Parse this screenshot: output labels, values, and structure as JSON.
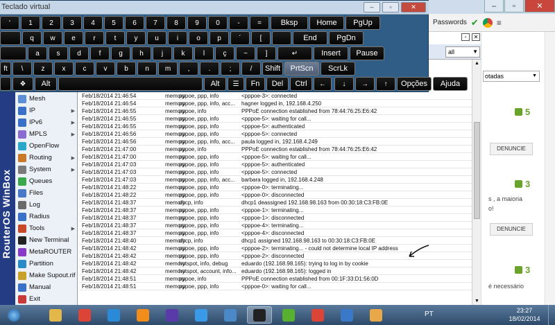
{
  "keyboard": {
    "title": "Teclado virtual",
    "rows": [
      [
        "'",
        "1",
        "2",
        "3",
        "4",
        "5",
        "6",
        "7",
        "8",
        "9",
        "0",
        "-",
        "=",
        "Bksp",
        "Home",
        "PgUp"
      ],
      [
        "",
        "q",
        "w",
        "e",
        "r",
        "t",
        "y",
        "u",
        "i",
        "o",
        "p",
        "´",
        "[",
        "",
        "End",
        "PgDn"
      ],
      [
        "",
        "a",
        "s",
        "d",
        "f",
        "g",
        "h",
        "j",
        "k",
        "l",
        "ç",
        "~",
        "]",
        "",
        "Insert",
        "Pause"
      ],
      [
        "ft",
        "\\",
        "z",
        "x",
        "c",
        "v",
        "b",
        "n",
        "m",
        ",",
        ".",
        ";",
        "/",
        "Shift",
        "PrtScn",
        "ScrLk"
      ],
      [
        "",
        "",
        "Alt",
        "",
        "Alt",
        "",
        "Fn",
        "Del",
        "Ctrl",
        "",
        "",
        "",
        "",
        "Opções",
        "Ajuda"
      ]
    ],
    "shift_chars": [
      "\"",
      "!",
      "@",
      "#",
      "$",
      "%",
      "¨",
      "&",
      "*",
      "(",
      ")",
      "_",
      "+"
    ],
    "alt_chars": {
      "2": "²",
      "3": "³",
      "4": "£",
      "5": "¢",
      "6": "¬",
      "=": "§",
      "´": "`",
      "[": "{",
      "ç": "Ç",
      "~": "^",
      "]": "}",
      ",": "<",
      ".": ">",
      ";": ":",
      "/": "?"
    }
  },
  "chrome": {
    "passwords": "Passwords",
    "menu": "≡"
  },
  "winbox": {
    "filter": "all",
    "brand": "RouterOS WinBox",
    "menu": [
      {
        "label": "Mesh",
        "color": "#5c8fd6",
        "sub": false
      },
      {
        "label": "IP",
        "color": "#3a70c8",
        "sub": true
      },
      {
        "label": "IPv6",
        "color": "#3a70c8",
        "sub": true
      },
      {
        "label": "MPLS",
        "color": "#8a6bcf",
        "sub": true
      },
      {
        "label": "OpenFlow",
        "color": "#2aa6c8",
        "sub": false
      },
      {
        "label": "Routing",
        "color": "#c87a2a",
        "sub": true
      },
      {
        "label": "System",
        "color": "#7a7a7a",
        "sub": true
      },
      {
        "label": "Queues",
        "color": "#3aa84a",
        "sub": false
      },
      {
        "label": "Files",
        "color": "#4a78c8",
        "sub": false
      },
      {
        "label": "Log",
        "color": "#6a6a6a",
        "sub": false
      },
      {
        "label": "Radius",
        "color": "#3a70c8",
        "sub": false
      },
      {
        "label": "Tools",
        "color": "#c84a2a",
        "sub": true
      },
      {
        "label": "New Terminal",
        "color": "#222222",
        "sub": false
      },
      {
        "label": "MetaROUTER",
        "color": "#8a3ac8",
        "sub": false
      },
      {
        "label": "Partition",
        "color": "#2a8ac8",
        "sub": false
      },
      {
        "label": "Make Supout.rif",
        "color": "#c8a02a",
        "sub": false
      },
      {
        "label": "Manual",
        "color": "#3a70c8",
        "sub": false
      },
      {
        "label": "Exit",
        "color": "#c83a3a",
        "sub": false
      }
    ],
    "log": [
      [
        "Feb/18/2014 21:46:54",
        "memory",
        "pppoe, ppp, info",
        "<pppoe-3>: connected"
      ],
      [
        "Feb/18/2014 21:46:54",
        "memory",
        "pppoe, ppp, info, acc...",
        "hagner logged in, 192.168.4.250"
      ],
      [
        "Feb/18/2014 21:46:55",
        "memory",
        "pppoe, info",
        "PPPoE connection established from 78:44:76:25:E6:42"
      ],
      [
        "Feb/18/2014 21:46:55",
        "memory",
        "pppoe, ppp, info",
        "<pppoe-5>: waiting for call..."
      ],
      [
        "Feb/18/2014 21:46:55",
        "memory",
        "pppoe, ppp, info",
        "<pppoe-5>: authenticated"
      ],
      [
        "Feb/18/2014 21:46:56",
        "memory",
        "pppoe, ppp, info",
        "<pppoe-5>: connected"
      ],
      [
        "Feb/18/2014 21:46:56",
        "memory",
        "pppoe, ppp, info, acc...",
        "paula logged in, 192.168.4.249"
      ],
      [
        "Feb/18/2014 21:47:00",
        "memory",
        "pppoe, info",
        "PPPoE connection established from 78:44:76:25:E6:42"
      ],
      [
        "Feb/18/2014 21:47:00",
        "memory",
        "pppoe, ppp, info",
        "<pppoe-5>: waiting for call..."
      ],
      [
        "Feb/18/2014 21:47:03",
        "memory",
        "pppoe, ppp, info",
        "<pppoe-5>: authenticated"
      ],
      [
        "Feb/18/2014 21:47:03",
        "memory",
        "pppoe, ppp, info",
        "<pppoe-5>: connected"
      ],
      [
        "Feb/18/2014 21:47:03",
        "memory",
        "pppoe, ppp, info, acc...",
        "barbara logged in, 192.168.4.248"
      ],
      [
        "Feb/18/2014 21:48:22",
        "memory",
        "pppoe, ppp, info",
        "<pppoe-0>: terminating..."
      ],
      [
        "Feb/18/2014 21:48:22",
        "memory",
        "pppoe, ppp, info",
        "<pppoe-0>: disconnected"
      ],
      [
        "Feb/18/2014 21:48:37",
        "memory",
        "dhcp, info",
        "dhcp1 deassigned 192.168.98.163 from 00:30:18:C3:FB:0E"
      ],
      [
        "Feb/18/2014 21:48:37",
        "memory",
        "pppoe, ppp, info",
        "<pppoe-1>: terminating..."
      ],
      [
        "Feb/18/2014 21:48:37",
        "memory",
        "pppoe, ppp, info",
        "<pppoe-1>: disconnected"
      ],
      [
        "Feb/18/2014 21:48:37",
        "memory",
        "pppoe, ppp, info",
        "<pppoe-4>: terminating..."
      ],
      [
        "Feb/18/2014 21:48:37",
        "memory",
        "pppoe, ppp, info",
        "<pppoe-4>: disconnected"
      ],
      [
        "Feb/18/2014 21:48:40",
        "memory",
        "dhcp, info",
        "dhcp1 assigned 192.168.98.163 to 00:30:18:C3:FB:0E"
      ],
      [
        "Feb/18/2014 21:48:42",
        "memory",
        "pppoe, ppp, info",
        "<pppoe-2>: terminating... - could not determine local IP address"
      ],
      [
        "Feb/18/2014 21:48:42",
        "memory",
        "pppoe, ppp, info",
        "<pppoe-2>: disconnected"
      ],
      [
        "Feb/18/2014 21:48:42",
        "memory",
        "hotspot, info, debug",
        "eduardo (192.168.98.165): trying to log in by cookie"
      ],
      [
        "Feb/18/2014 21:48:42",
        "memory",
        "hotspot, account, info...",
        "eduardo (192.168.98.165): logged in"
      ],
      [
        "Feb/18/2014 21:48:51",
        "memory",
        "pppoe, info",
        "PPPoE connection established from 00:1F:33:D1:56:0D"
      ],
      [
        "Feb/18/2014 21:48:51",
        "memory",
        "pppoe, ppp, info",
        "<pppoe-0>: waiting for call..."
      ]
    ]
  },
  "web": {
    "select": "otadas",
    "votes": [
      "5",
      "3",
      "3"
    ],
    "denuncie": "DENUNCIE",
    "snippets": [
      "s , a maioria",
      "o!",
      "é necessário"
    ]
  },
  "taskbar": {
    "apps": [
      {
        "name": "windows-explorer-icon",
        "color": "#e4b74a",
        "active": false
      },
      {
        "name": "chrome-icon",
        "color": "#db4437",
        "active": false
      },
      {
        "name": "ie-icon",
        "color": "#2a8ad8",
        "active": false
      },
      {
        "name": "media-player-icon",
        "color": "#f28c1a",
        "active": false
      },
      {
        "name": "download-icon",
        "color": "#5a3aa8",
        "active": false
      },
      {
        "name": "globe-icon",
        "color": "#3a9ae8",
        "active": false
      },
      {
        "name": "network-icon",
        "color": "#4a88c8",
        "active": false
      },
      {
        "name": "terminal-icon",
        "color": "#222222",
        "active": true
      },
      {
        "name": "utorrent-icon",
        "color": "#58b030",
        "active": false
      },
      {
        "name": "chrome2-icon",
        "color": "#db4437",
        "active": false
      },
      {
        "name": "winbox-icon",
        "color": "#3a78c8",
        "active": false
      },
      {
        "name": "paint-icon",
        "color": "#e8a84a",
        "active": false
      }
    ],
    "lang": "PT",
    "time": "23:27",
    "date": "18/02/2014"
  }
}
